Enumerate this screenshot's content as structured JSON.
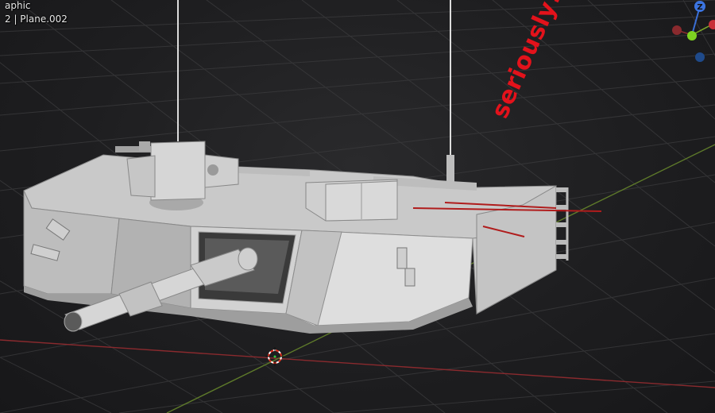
{
  "viewport": {
    "overlay_line1": "aphic",
    "overlay_line2": "2 | Plane.002",
    "colors": {
      "background": "#1c1c1e",
      "grid": "#3a3a3c",
      "x_axis": "#8a2a2e",
      "y_axis": "#5e7a2a",
      "model": "#cfcfcf",
      "annotation": "#e3121b"
    }
  },
  "gizmo": {
    "z_label": "Z",
    "axes": [
      "x-axis-red",
      "y-axis-green",
      "z-axis-blue",
      "neg-x-dark-red",
      "neg-y-dark-blue"
    ]
  },
  "annotation": {
    "text": "seriously!?"
  },
  "model": {
    "description_icon": "tank-turret-model"
  }
}
